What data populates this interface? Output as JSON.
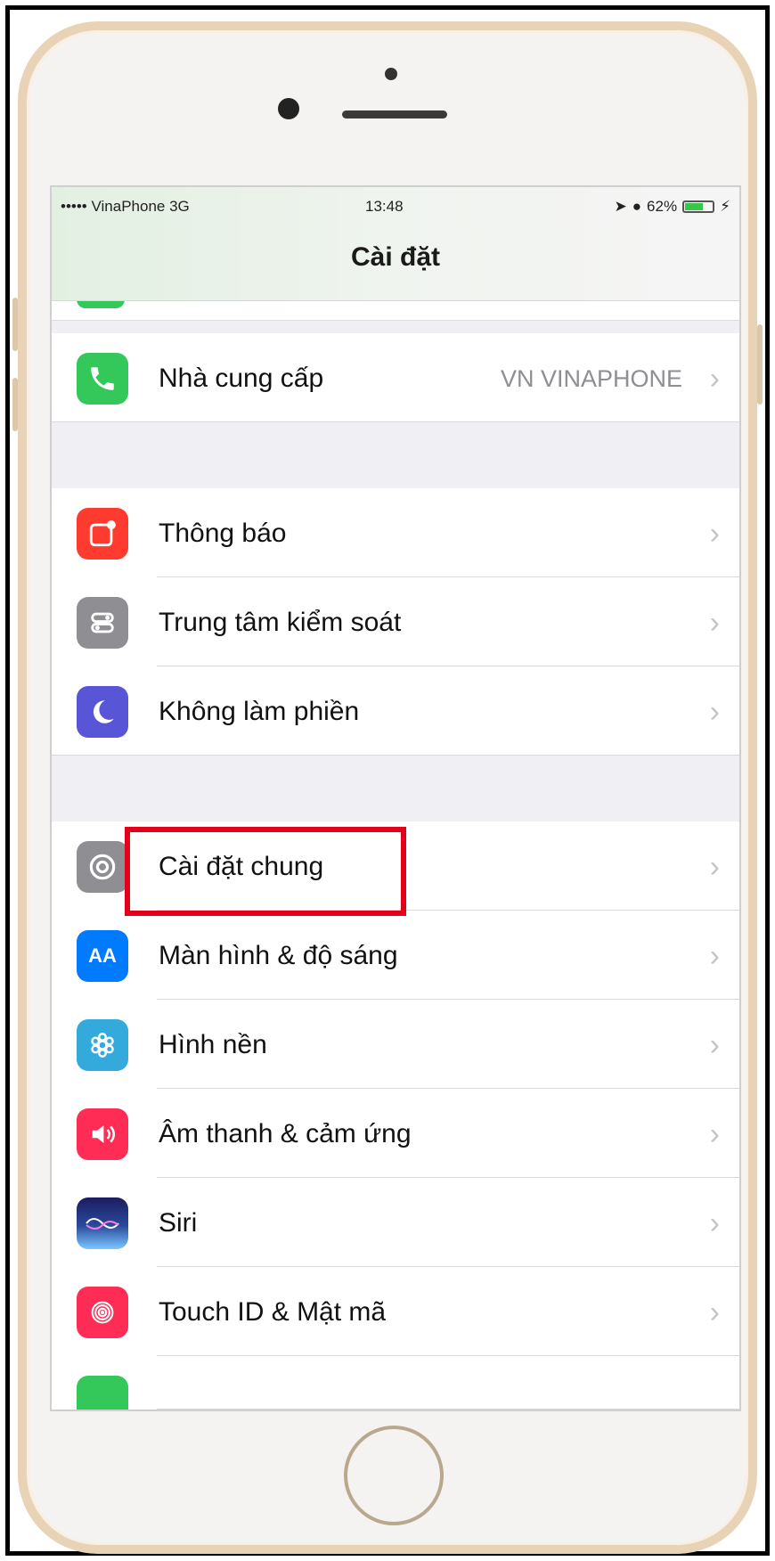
{
  "status_bar": {
    "carrier": "••••• VinaPhone  3G",
    "time": "13:48",
    "battery": "62%",
    "battery_level": 0.62
  },
  "nav": {
    "title": "Cài đặt"
  },
  "rows": {
    "carrier": {
      "label": "Nhà cung cấp",
      "value": "VN VINAPHONE",
      "icon": "phone-icon",
      "color": "#34c759"
    },
    "notifications": {
      "label": "Thông báo",
      "icon": "notifications-icon",
      "color": "#ff3b30"
    },
    "control_center": {
      "label": "Trung tâm kiểm soát",
      "icon": "control-center-icon",
      "color": "#8e8e93"
    },
    "dnd": {
      "label": "Không làm phiền",
      "icon": "moon-icon",
      "color": "#5856d6"
    },
    "general": {
      "label": "Cài đặt chung",
      "icon": "gear-icon",
      "color": "#8e8e93"
    },
    "display": {
      "label": "Màn hình & độ sáng",
      "icon": "display-icon",
      "color": "#007aff"
    },
    "wallpaper": {
      "label": "Hình nền",
      "icon": "wallpaper-icon",
      "color": "#34aadc"
    },
    "sounds": {
      "label": "Âm thanh & cảm ứng",
      "icon": "speaker-icon",
      "color": "#ff2d55"
    },
    "siri": {
      "label": "Siri",
      "icon": "siri-icon",
      "color": "#1c1c5e"
    },
    "touch_id": {
      "label": "Touch ID & Mật mã",
      "icon": "fingerprint-icon",
      "color": "#ff2d55"
    }
  },
  "icons": {
    "display_text": "AA"
  },
  "highlight": {
    "target": "Cài đặt chung",
    "color": "#e2001a"
  }
}
